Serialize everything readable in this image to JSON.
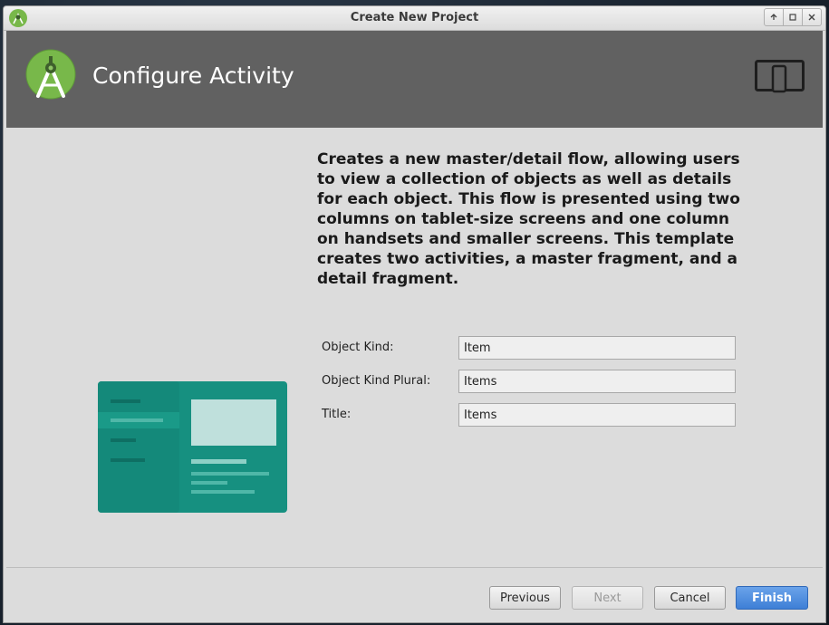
{
  "window": {
    "title": "Create New Project",
    "controls": [
      "minimize",
      "maximize",
      "close"
    ]
  },
  "header": {
    "title": "Configure Activity",
    "logo_icon": "android-studio-icon",
    "device_icon": "tablet-phone-icon",
    "background": "#616161"
  },
  "main": {
    "description": "Creates a new master/detail flow, allowing users to view a collection of objects as well as details for each object. This flow is presented using two columns on tablet-size screens and one column on handsets and smaller screens. This template creates two activities, a master fragment, and a detail fragment.",
    "fields": [
      {
        "label": "Object Kind:",
        "value": "Item"
      },
      {
        "label": "Object Kind Plural:",
        "value": "Items"
      },
      {
        "label": "Title:",
        "value": "Items"
      }
    ],
    "preview_icon": "master-detail-template-preview",
    "preview_color": "#169080"
  },
  "footer": {
    "previous_label": "Previous",
    "next_label": "Next",
    "cancel_label": "Cancel",
    "finish_label": "Finish",
    "accent": "#4a89dc"
  }
}
